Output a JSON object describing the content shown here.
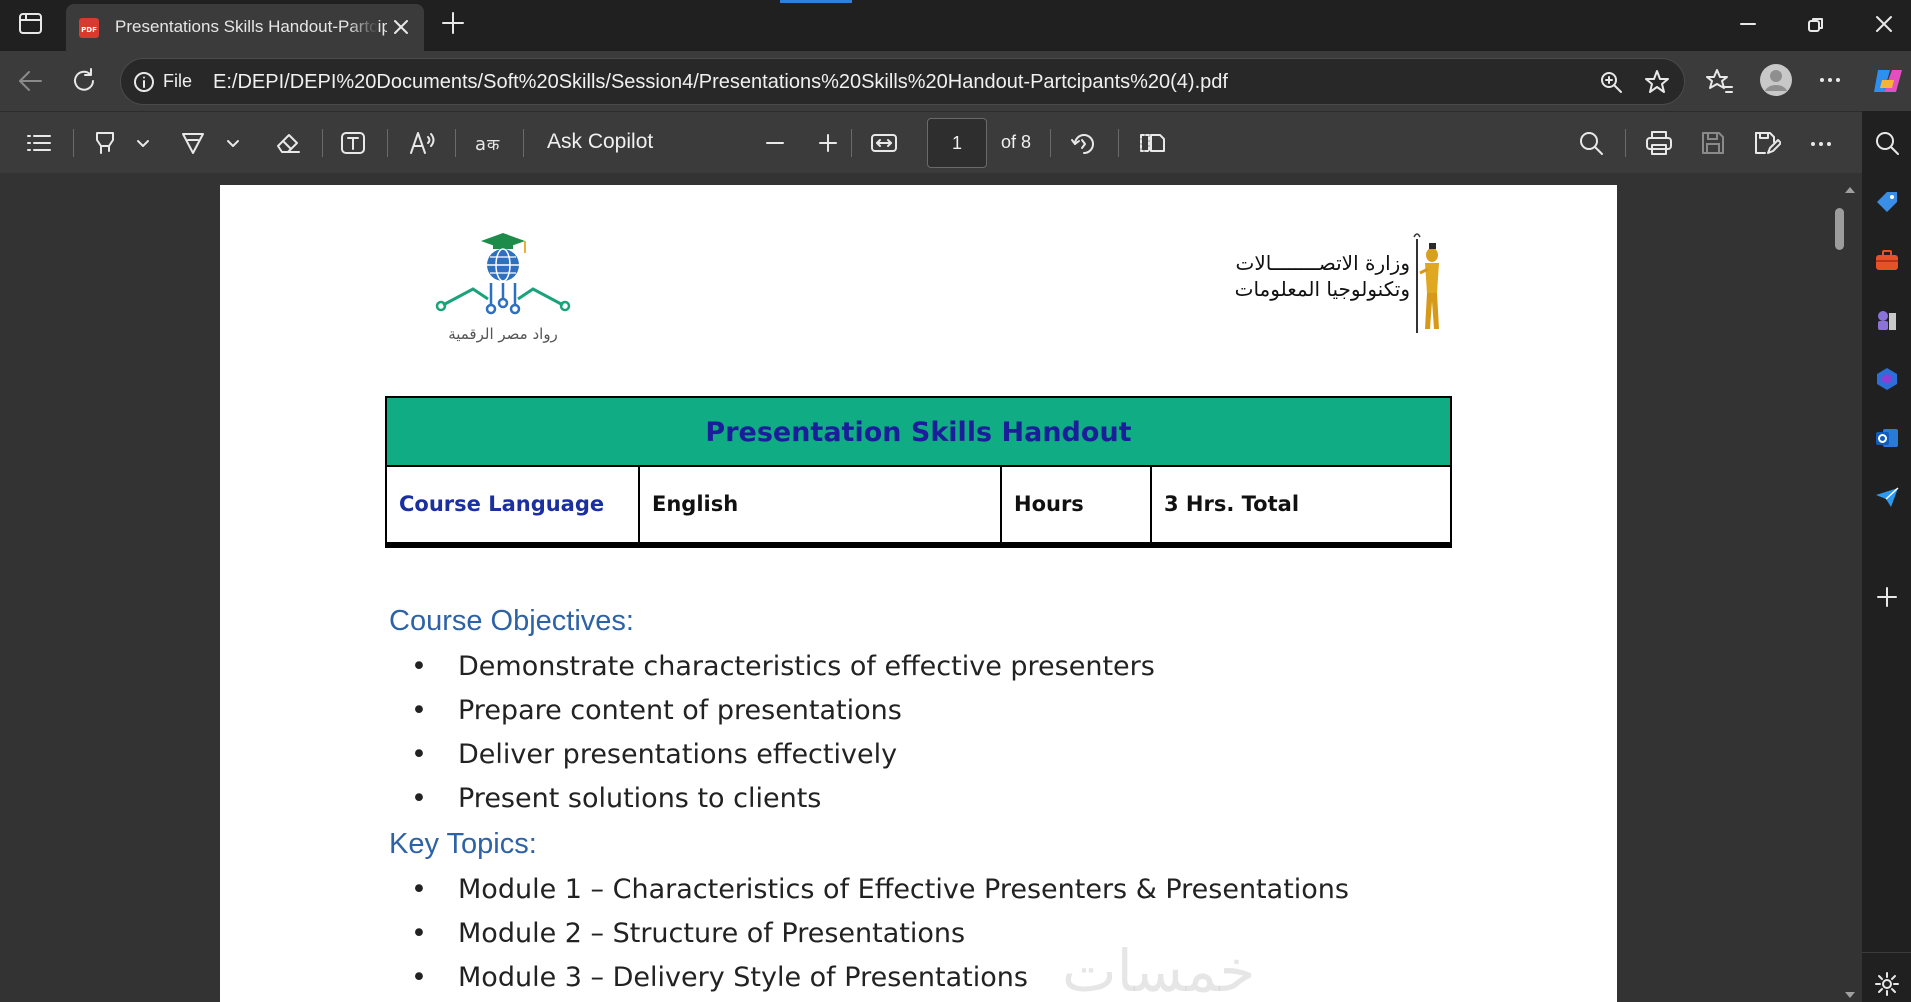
{
  "browser": {
    "tab_title": "Presentations Skills Handout-Partcipants (4).pdf",
    "file_label": "File",
    "url": "E:/DEPI/DEPI%20Documents/Soft%20Skills/Session4/Presentations%20Skills%20Handout-Partcipants%20(4).pdf"
  },
  "pdf_toolbar": {
    "copilot_label": "Ask Copilot",
    "page_current": "1",
    "page_total_label": "of 8"
  },
  "document": {
    "logo_left_caption": "رواد مصر الرقمية",
    "logo_right_line1": "وزارة الاتصــــــــالات",
    "logo_right_line2": "وتكنولوجيا المعلومات",
    "header_table": {
      "title": "Presentation Skills Handout",
      "cells": [
        "Course Language",
        "English",
        "Hours",
        "3 Hrs. Total"
      ]
    },
    "objectives_heading": "Course Objectives:",
    "objectives": [
      "Demonstrate characteristics of effective presenters",
      "Prepare content of presentations",
      "Deliver presentations effectively",
      "Present solutions to clients"
    ],
    "topics_heading": "Key Topics:",
    "topics": [
      "Module 1 – Characteristics of Effective Presenters & Presentations",
      "Module 2 – Structure of Presentations",
      "Module 3 – Delivery Style of Presentations"
    ],
    "watermark": "خمسات"
  },
  "colors": {
    "header_green": "#10ac83",
    "header_title_blue": "#1b1e9a",
    "section_blue": "#2e62a6"
  }
}
